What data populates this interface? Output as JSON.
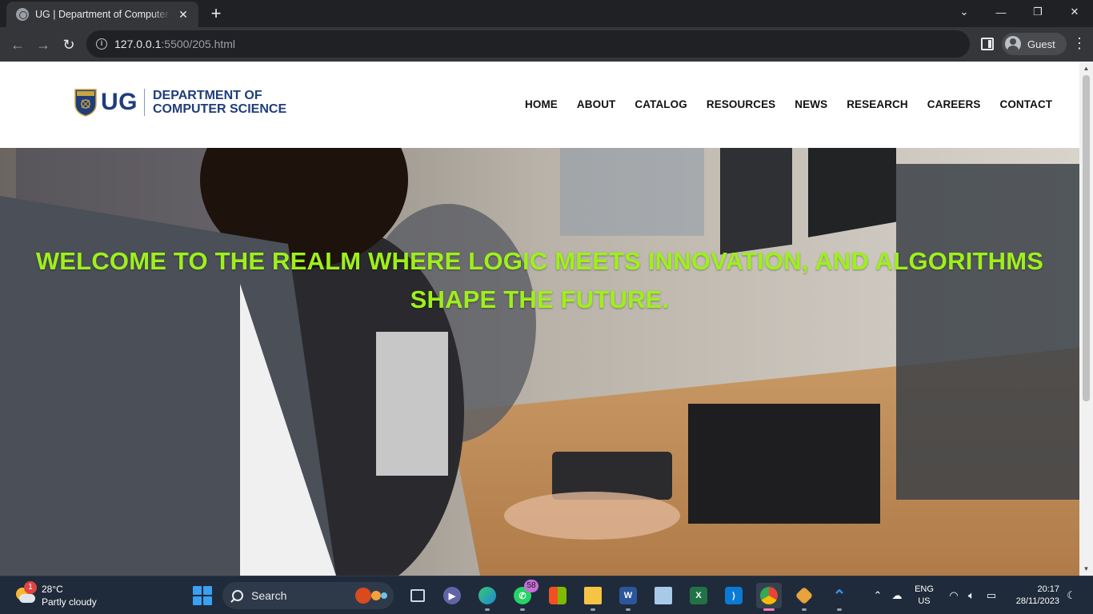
{
  "browser": {
    "tab_title": "UG | Department of Computer Science",
    "new_tab": "+",
    "tab_close": "✕",
    "url_host": "127.0.0.1",
    "url_path": ":5500/205.html",
    "profile_name": "Guest",
    "window_controls": {
      "tab_search": "⌄",
      "minimize": "—",
      "restore": "❐",
      "close": "✕"
    },
    "nav": {
      "back": "←",
      "forward": "→",
      "reload": "↻",
      "menu": "⋮"
    }
  },
  "site": {
    "logo": {
      "ug": "UG",
      "dept_line1": "DEPARTMENT OF",
      "dept_line2": "COMPUTER SCIENCE"
    },
    "nav": [
      "HOME",
      "ABOUT",
      "CATALOG",
      "RESOURCES",
      "NEWS",
      "RESEARCH",
      "CAREERS",
      "CONTACT"
    ],
    "hero_text": "WELCOME TO THE REALM WHERE LOGIC MEETS INNOVATION, AND ALGORITHMS SHAPE THE FUTURE.",
    "colors": {
      "logo_blue": "#1f3d7a",
      "hero_text": "#9ef01a"
    }
  },
  "taskbar": {
    "weather": {
      "badge": "1",
      "temp": "28°C",
      "desc": "Partly cloudy"
    },
    "search_label": "Search",
    "whatsapp_badge": "58",
    "apps": [
      "task-view",
      "teams",
      "edge",
      "whatsapp",
      "store",
      "file-explorer",
      "word",
      "notepad",
      "excel",
      "vscode",
      "chrome",
      "git",
      "arc"
    ],
    "tray": {
      "lang1": "ENG",
      "lang2": "US",
      "time": "20:17",
      "date": "28/11/2023"
    }
  }
}
